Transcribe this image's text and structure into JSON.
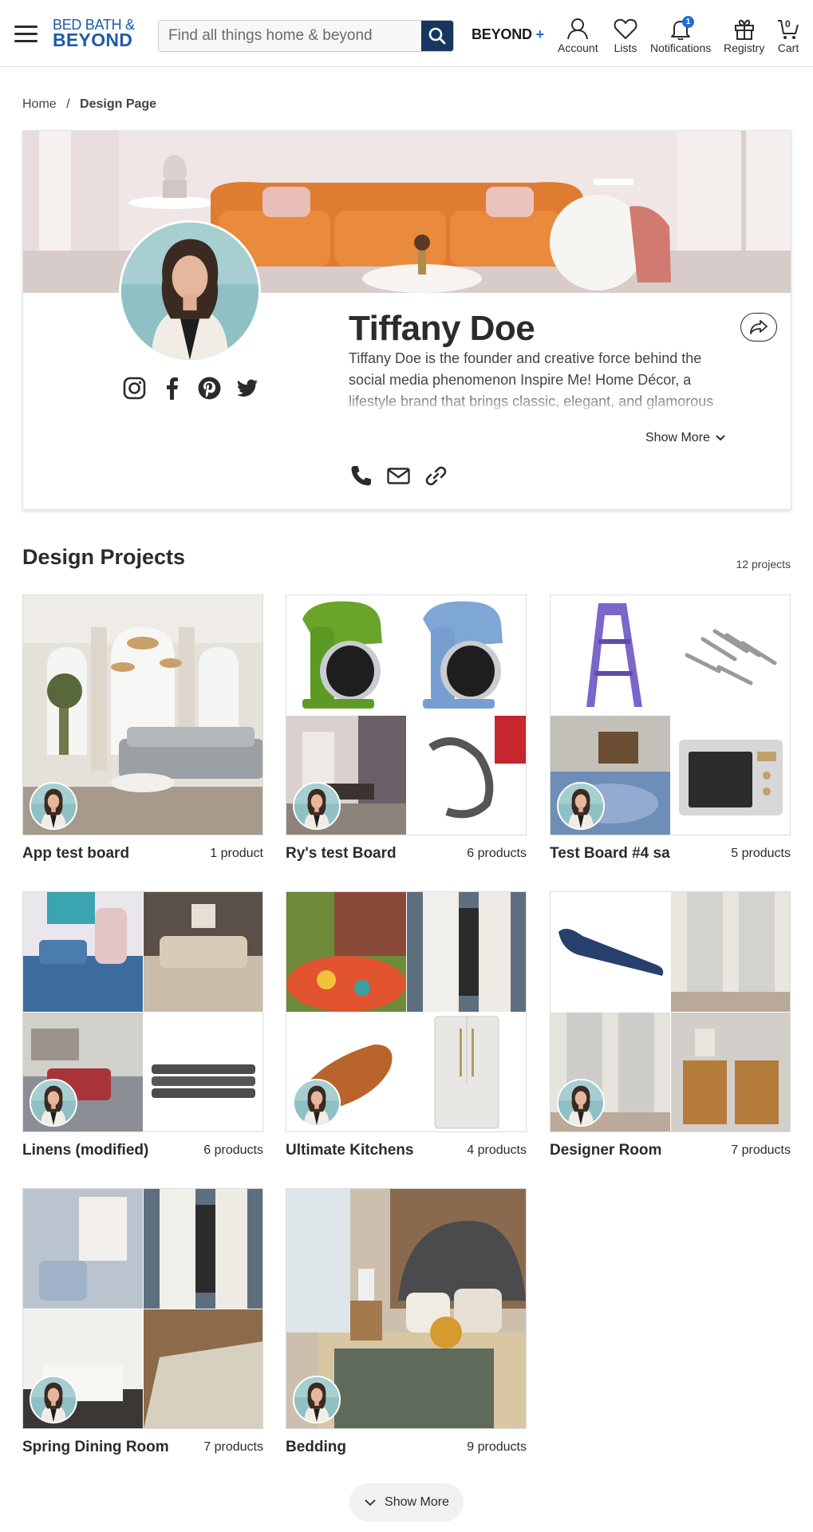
{
  "header": {
    "logo_line1": "BED BATH &",
    "logo_line2": "BEYOND",
    "search_placeholder": "Find all things home & beyond",
    "beyond_label": "BEYOND",
    "beyond_plus": "+",
    "nav": {
      "account": "Account",
      "lists": "Lists",
      "notifications": "Notifications",
      "notifications_badge": "1",
      "registry": "Registry",
      "cart": "Cart",
      "cart_count": "0"
    },
    "colors": {
      "brand_blue": "#1f5aa6",
      "search_button": "#17365d",
      "badge": "#1f6fd0"
    }
  },
  "breadcrumb": {
    "home": "Home",
    "separator": "/",
    "current": "Design Page"
  },
  "profile": {
    "name": "Tiffany Doe",
    "bio": "Tiffany Doe is the founder and creative force behind the social media phenomenon Inspire Me! Home Décor, a lifestyle brand that brings classic, elegant, and glamorous style to your home.",
    "show_more": "Show More",
    "socials": [
      "instagram-icon",
      "facebook-icon",
      "pinterest-icon",
      "twitter-icon"
    ],
    "contacts": [
      "phone-icon",
      "mail-icon",
      "link-icon"
    ]
  },
  "projects": {
    "title": "Design Projects",
    "count": "12 projects",
    "items": [
      {
        "title": "App test board",
        "count": "1 product"
      },
      {
        "title": "Ry's test Board",
        "count": "6 products"
      },
      {
        "title": "Test Board #4 sa",
        "count": "5 products"
      },
      {
        "title": "Linens (modified)",
        "count": "6 products"
      },
      {
        "title": "Ultimate Kitchens",
        "count": "4 products"
      },
      {
        "title": "Designer Room",
        "count": "7 products"
      },
      {
        "title": "Spring Dining Room",
        "count": "7 products"
      },
      {
        "title": "Bedding",
        "count": "9 products"
      }
    ],
    "show_more": "Show More"
  }
}
